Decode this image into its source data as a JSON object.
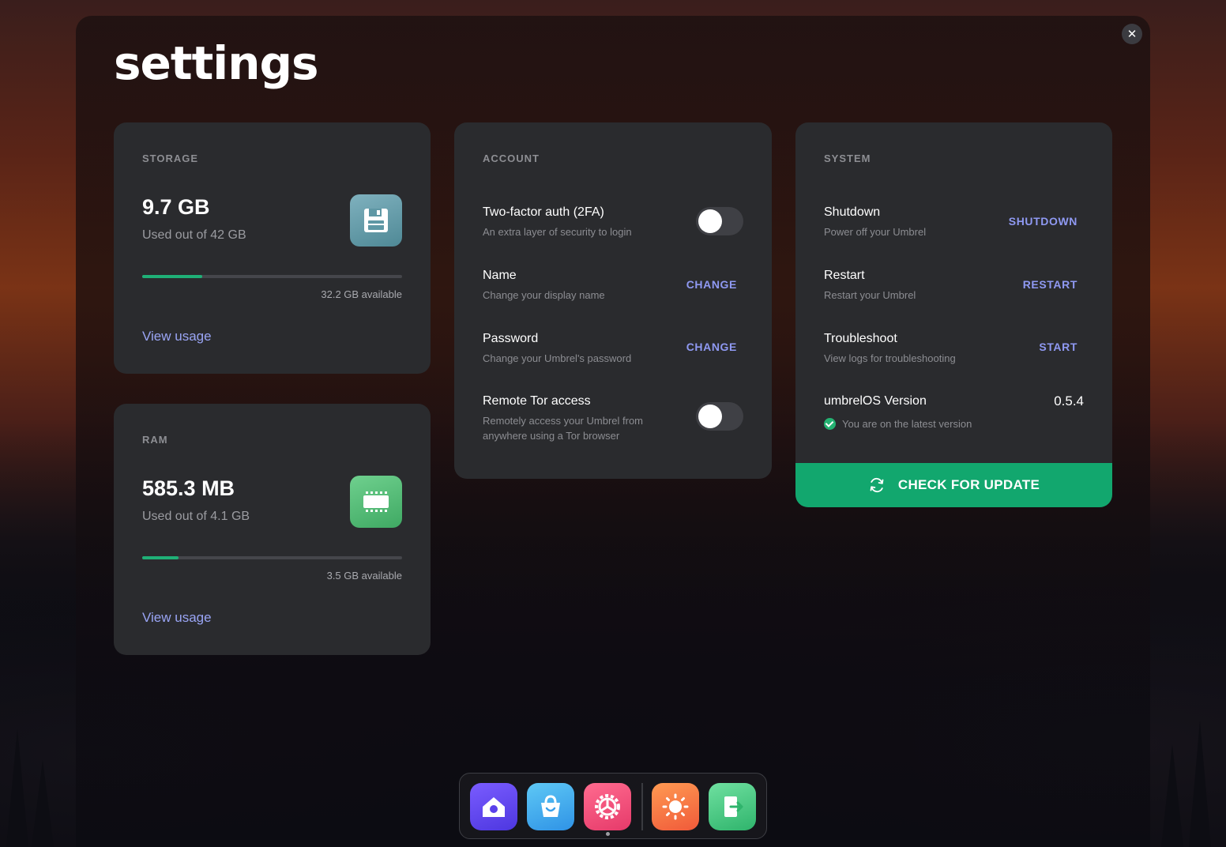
{
  "page": {
    "title": "settings",
    "close_label": "✕"
  },
  "storage": {
    "label": "STORAGE",
    "used": "9.7 GB",
    "used_of": "Used out of 42 GB",
    "available": "32.2 GB available",
    "progress_fraction": 0.23,
    "link": "View usage",
    "icon": "floppy-disk-icon"
  },
  "ram": {
    "label": "RAM",
    "used": "585.3 MB",
    "used_of": "Used out of 4.1 GB",
    "available": "3.5 GB available",
    "progress_fraction": 0.14,
    "link": "View usage",
    "icon": "memory-chip-icon"
  },
  "account": {
    "label": "ACCOUNT",
    "twofa": {
      "title": "Two-factor auth (2FA)",
      "desc": "An extra layer of security to login",
      "enabled": false
    },
    "name": {
      "title": "Name",
      "desc": "Change your display name",
      "action": "CHANGE"
    },
    "password": {
      "title": "Password",
      "desc": "Change your Umbrel's password",
      "action": "CHANGE"
    },
    "tor": {
      "title": "Remote Tor access",
      "desc_line1": "Remotely access your Umbrel from",
      "desc_line2": "anywhere using a Tor browser",
      "enabled": false
    }
  },
  "system": {
    "label": "SYSTEM",
    "shutdown": {
      "title": "Shutdown",
      "desc": "Power off your Umbrel",
      "action": "SHUTDOWN"
    },
    "restart": {
      "title": "Restart",
      "desc": "Restart your Umbrel",
      "action": "RESTART"
    },
    "troubleshoot": {
      "title": "Troubleshoot",
      "desc": "View logs for troubleshooting",
      "action": "START"
    },
    "version": {
      "title": "umbrelOS Version",
      "value": "0.5.4",
      "status": "You are on the latest version"
    },
    "update_button": "CHECK FOR UPDATE"
  },
  "dock": {
    "items": [
      "home-icon",
      "app-store-icon",
      "settings-icon",
      "weather-icon",
      "exit-icon"
    ],
    "active": "settings-icon"
  },
  "colors": {
    "accent_link": "#8f99f2",
    "progress": "#1fb077",
    "update_button": "#12a76e",
    "card_bg": "#2a2b2e"
  }
}
